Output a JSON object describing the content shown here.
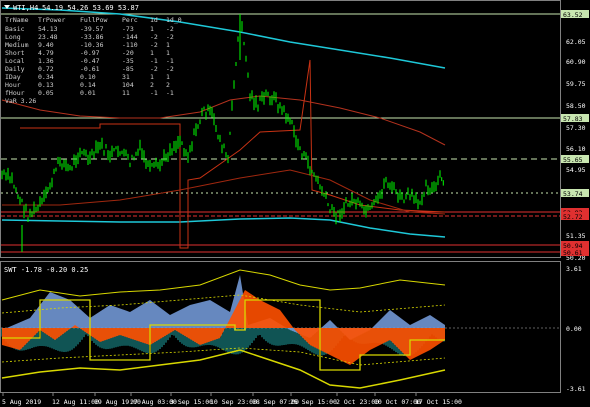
{
  "window": {
    "title": "WTI,H4",
    "ohlc": "54.19 54.26 53.69 53.87"
  },
  "stats_table": {
    "headers": [
      "TrName",
      "TrPower",
      "FullPow",
      "Perc",
      "1d",
      "1d_0"
    ],
    "rows": [
      [
        "Basic",
        "54.13",
        "-39.57",
        "-73",
        "1",
        "-2"
      ],
      [
        "Long",
        "23.48",
        "-33.86",
        "-144",
        "-2",
        "-2"
      ],
      [
        "Medium",
        "9.40",
        "-10.36",
        "-110",
        "-2",
        "1"
      ],
      [
        "Short",
        "4.79",
        "-0.97",
        "-20",
        "1",
        "1"
      ],
      [
        "Local",
        "1.36",
        "-0.47",
        "-35",
        "-1",
        "-1"
      ],
      [
        "Daily",
        "0.72",
        "-0.61",
        "-85",
        "-2",
        "-2"
      ],
      [
        "IDay",
        "0.34",
        "0.10",
        "31",
        "1",
        "1"
      ],
      [
        "Hour",
        "0.13",
        "0.14",
        "104",
        "2",
        "2"
      ],
      [
        "fHour",
        "0.05",
        "0.01",
        "11",
        "-1",
        "-1"
      ]
    ],
    "footer": "VaR 3.26"
  },
  "price_axis": {
    "labels": [
      "62.05",
      "60.90",
      "59.75",
      "58.50",
      "57.30",
      "56.10",
      "54.95",
      "53.80",
      "52.65",
      "51.35",
      "50.20"
    ],
    "tags": [
      {
        "label": "63.52",
        "color": "#c8e6b0"
      },
      {
        "label": "57.83",
        "color": "#c8e6b0"
      },
      {
        "label": "55.65",
        "color": "#c8e6b0"
      },
      {
        "label": "53.74",
        "color": "#c8e6b0"
      },
      {
        "label": "52.93",
        "color": "#e03030"
      },
      {
        "label": "52.72",
        "color": "#e03030"
      },
      {
        "label": "50.94",
        "color": "#e03030"
      },
      {
        "label": "50.61",
        "color": "#e03030"
      }
    ]
  },
  "indicator": {
    "label": "SWT -1.78 -0.20 0.25",
    "axis_labels": [
      "3.61",
      "0.00",
      "-3.61"
    ]
  },
  "time_axis": {
    "labels": [
      "5 Aug 2019",
      "12 Aug 11:00",
      "19 Aug 19:00",
      "27 Aug 03:00",
      "3 Sep 15:00",
      "10 Sep 23:00",
      "18 Sep 07:00",
      "25 Sep 15:00",
      "2 Oct 23:00",
      "10 Oct 07:00",
      "17 Oct 15:00"
    ]
  },
  "colors": {
    "background": "#000000",
    "candle": "#00ff00",
    "ma_cyan": "#1ec8d8",
    "ma_red": "#c83214",
    "level_yellow": "#d8d800",
    "hist_teal": "#20a8a8",
    "osc_orange": "#ff5000",
    "osc_blue": "#78a0e0"
  }
}
